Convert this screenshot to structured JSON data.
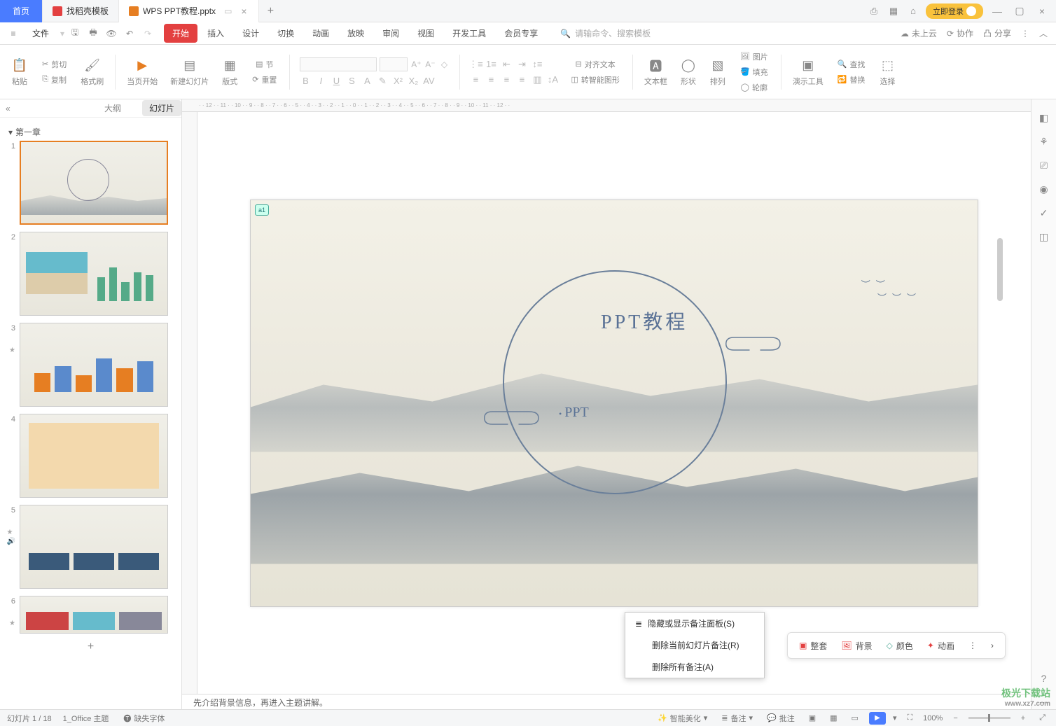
{
  "titlebar": {
    "home": "首页",
    "tab_templates": "找稻壳模板",
    "tab_file": "WPS PPT教程.pptx",
    "login": "立即登录"
  },
  "menubar": {
    "file": "文件",
    "tabs": [
      "开始",
      "插入",
      "设计",
      "切换",
      "动画",
      "放映",
      "审阅",
      "视图",
      "开发工具",
      "会员专享"
    ],
    "search_ph": "请输命令、搜索模板",
    "cloud": "未上云",
    "coop": "协作",
    "share": "分享"
  },
  "ribbon": {
    "paste": "粘贴",
    "cut": "剪切",
    "copy": "复制",
    "format_painter": "格式刷",
    "from_current": "当页开始",
    "new_slide": "新建幻灯片",
    "layout": "版式",
    "section": "节",
    "reset": "重置",
    "textbox": "文本框",
    "shape": "形状",
    "arrange": "排列",
    "picture": "图片",
    "fill": "填充",
    "outline": "轮廓",
    "align_h": "对齐文本",
    "to_smart": "转智能图形",
    "find": "查找",
    "replace": "替换",
    "present_tools": "演示工具",
    "select": "选择"
  },
  "sidebar": {
    "outline": "大纲",
    "slides": "幻灯片",
    "section1": "第一章",
    "thumbs": [
      1,
      2,
      3,
      4,
      5,
      6
    ]
  },
  "slide": {
    "badge": "a1",
    "title": "PPT教程",
    "sub": "PPT"
  },
  "quickbar": {
    "full": "整套",
    "bg": "背景",
    "color": "颜色",
    "anim": "动画"
  },
  "context_menu": {
    "toggle": "隐藏或显示备注面板(S)",
    "del_current": "删除当前幻灯片备注(R)",
    "del_all": "删除所有备注(A)"
  },
  "notes": "先介绍背景信息，再进入主题讲解。",
  "statusbar": {
    "slide_pos": "幻灯片 1 / 18",
    "theme": "1_Office 主题",
    "missing_font": "缺失字体",
    "smart": "智能美化",
    "notes_btn": "备注",
    "comments_btn": "批注",
    "zoom": "100%"
  },
  "watermark": {
    "name": "极光下载站",
    "url": "www.xz7.com"
  }
}
